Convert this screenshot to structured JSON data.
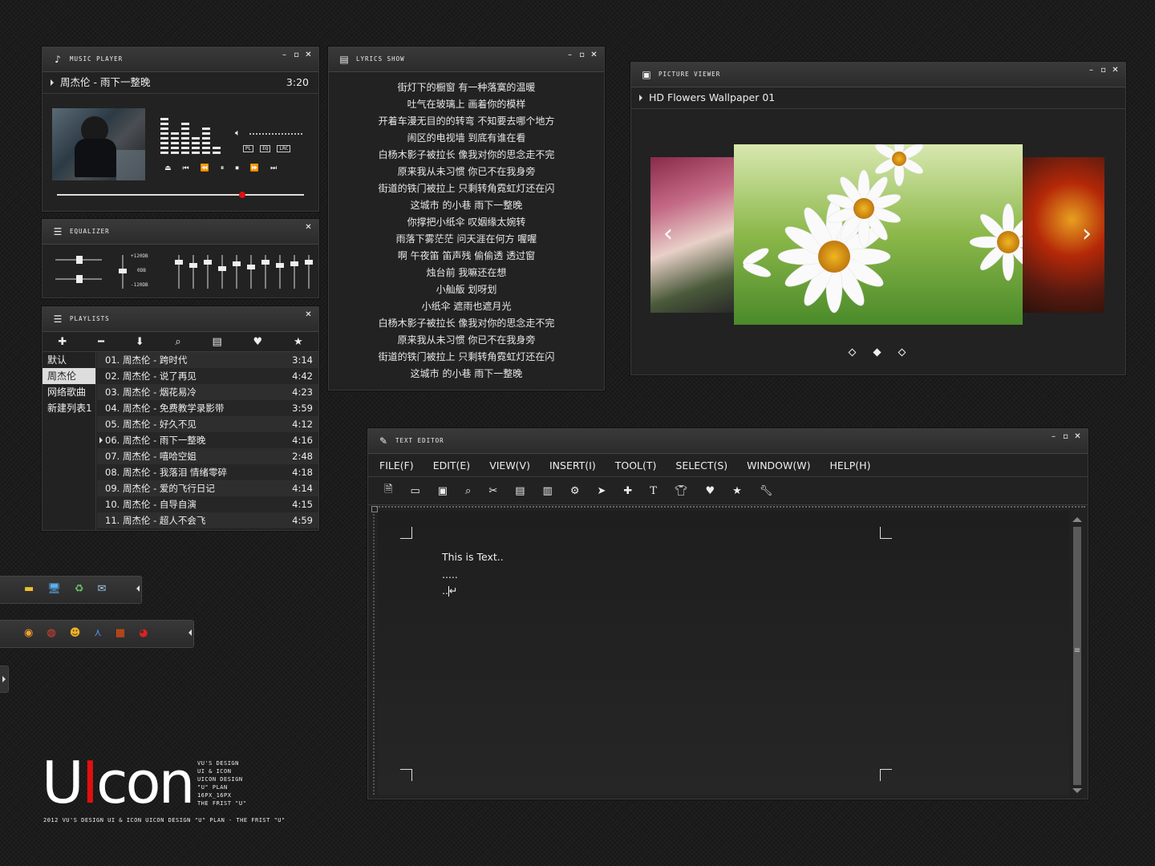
{
  "music_player": {
    "title": "MUSIC PLAYER",
    "now_playing": "周杰伦 - 雨下一整晚",
    "time": "3:20",
    "modes": [
      "PL",
      "EQ",
      "LRC"
    ],
    "progress": 0.75
  },
  "equalizer": {
    "title": "EQUALIZER",
    "db_top": "+120DB",
    "db_mid": "0DB",
    "db_bottom": "-120DB"
  },
  "playlists": {
    "title": "PLAYLISTS",
    "categories": [
      "默认",
      "周杰伦",
      "网络歌曲",
      "新建列表1"
    ],
    "selected_category": 1,
    "tracks": [
      {
        "label": "01. 周杰伦 - 跨时代",
        "time": "3:14"
      },
      {
        "label": "02. 周杰伦 - 说了再见",
        "time": "4:42"
      },
      {
        "label": "03. 周杰伦 - 烟花易冷",
        "time": "4:23"
      },
      {
        "label": "04. 周杰伦 - 免费教学录影带",
        "time": "3:59"
      },
      {
        "label": "05. 周杰伦 - 好久不见",
        "time": "4:12"
      },
      {
        "label": "06. 周杰伦 - 雨下一整晚",
        "time": "4:16"
      },
      {
        "label": "07. 周杰伦 - 嘻哈空姐",
        "time": "2:48"
      },
      {
        "label": "08. 周杰伦 - 我落泪 情绪零碎",
        "time": "4:18"
      },
      {
        "label": "09. 周杰伦 - 爱的飞行日记",
        "time": "4:14"
      },
      {
        "label": "10. 周杰伦 - 自导自演",
        "time": "4:15"
      },
      {
        "label": "11. 周杰伦 - 超人不会飞",
        "time": "4:59"
      }
    ],
    "playing_index": 5
  },
  "lyrics": {
    "title": "LYRICS SHOW",
    "lines": [
      "街灯下的橱窗 有一种落寞的温暖",
      "吐气在玻璃上 画着你的模样",
      "开着车漫无目的的转弯 不知要去哪个地方",
      "闹区的电视墙 到底有谁在看",
      "白杨木影子被拉长 像我对你的思念走不完",
      "原来我从未习惯 你已不在我身旁",
      "街道的铁门被拉上 只剩转角霓虹灯还在闪",
      "这城市 的小巷 雨下一整晚",
      "你撑把小纸伞 叹姻缘太婉转",
      "雨落下雾茫茫 问天涯在何方 喔喔",
      "啊 午夜笛 笛声残 偷偷透 透过窗",
      "烛台前 我嘛还在想",
      "小舢舨 划呀划",
      "小纸伞 遮雨也遮月光",
      "白杨木影子被拉长 像我对你的思念走不完",
      "原来我从未习惯 你已不在我身旁",
      "街道的铁门被拉上 只剩转角霓虹灯还在闪",
      "这城市 的小巷 雨下一整晚"
    ]
  },
  "picture_viewer": {
    "title": "PICTURE VIEWER",
    "image_name": "HD Flowers Wallpaper 01",
    "active_dot": 1
  },
  "text_editor": {
    "title": "TEXT EDITOR",
    "menu": [
      "FILE(F)",
      "EDIT(E)",
      "VIEW(V)",
      "INSERT(I)",
      "TOOL(T)",
      "SELECT(S)",
      "WINDOW(W)",
      "HELP(H)"
    ],
    "content_lines": [
      "This is Text..",
      "....."
    ],
    "cursor_line": ".."
  },
  "branding": {
    "logo": "UIcon",
    "info": [
      "VU'S DESIGN",
      "UI & ICON",
      "UICON DESIGN",
      "\"U\" PLAN",
      "16PX_16PX",
      "THE FRIST \"U\""
    ],
    "footer": "2012 VU'S DESIGN UI & ICON UICON DESIGN \"U\" PLAN - THE FRIST \"U\""
  },
  "colors": {
    "accent": "#e01010",
    "bg": "#1c1c1c",
    "panel": "#222222"
  }
}
